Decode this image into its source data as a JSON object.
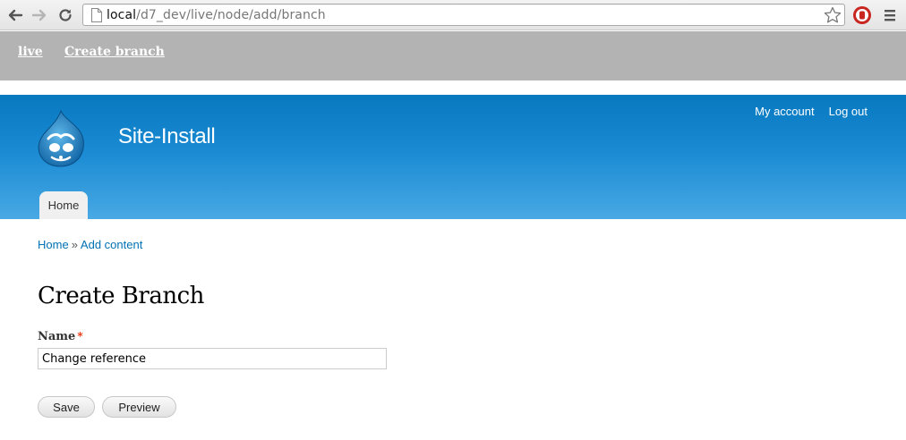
{
  "browser": {
    "url_host": "local",
    "url_path": "/d7_dev/live/node/add/branch"
  },
  "toolbar": {
    "links": [
      "live",
      "Create branch"
    ]
  },
  "header": {
    "site_name": "Site-Install",
    "secondary_menu": [
      "My account",
      "Log out"
    ],
    "main_menu": [
      "Home"
    ]
  },
  "breadcrumb": {
    "home": "Home",
    "separator": "»",
    "current": "Add content"
  },
  "page": {
    "title": "Create Branch"
  },
  "form": {
    "name_label": "Name",
    "required_marker": "*",
    "name_value": "Change reference",
    "save_label": "Save",
    "preview_label": "Preview"
  },
  "colors": {
    "toolbar_bg": "#b3b3b3",
    "header_top": "#0779bf",
    "header_bottom": "#48a9e4",
    "link": "#0071b3",
    "required": "#ea2800"
  },
  "icons": [
    "back-arrow-icon",
    "forward-arrow-icon",
    "reload-icon",
    "page-icon",
    "star-icon",
    "stop-extension-icon",
    "menu-icon",
    "drupal-logo"
  ]
}
